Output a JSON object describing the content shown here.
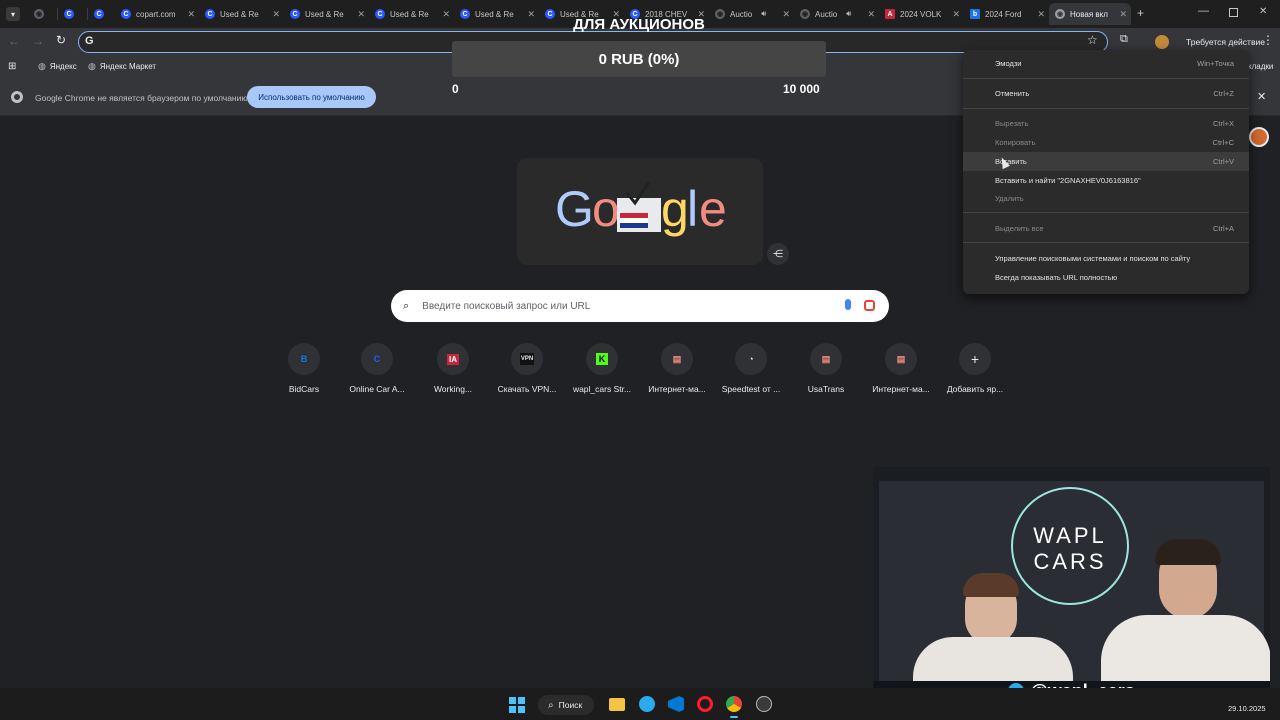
{
  "tabs": [
    {
      "title": ""
    },
    {
      "title": ""
    },
    {
      "title": "copart.com"
    },
    {
      "title": "Used & Re"
    },
    {
      "title": "Used & Re"
    },
    {
      "title": "Used & Re"
    },
    {
      "title": "Used & Re"
    },
    {
      "title": "Used & Re"
    },
    {
      "title": "2018 CHEV"
    },
    {
      "title": "Auctio"
    },
    {
      "title": "Auctio"
    },
    {
      "title": "2024 VOLK"
    },
    {
      "title": "2024 Ford"
    },
    {
      "title": "Новая вкл"
    }
  ],
  "toolbar": {
    "action_required": "Требуется действие"
  },
  "bookmarks": {
    "items": [
      "Яндекс",
      "Яндекс Маркет"
    ],
    "all_bookmarks_fragment": "кладки"
  },
  "infobar": {
    "text": "Google Chrome не является браузером по умолчанию.",
    "button": "Использовать по умолчанию"
  },
  "overlay": {
    "title": "ДЛЯ АУКЦИОНОВ",
    "amount": "0 RUB (0%)",
    "scale_min": "0",
    "scale_max": "10 000"
  },
  "search": {
    "placeholder": "Введите поисковый запрос или URL"
  },
  "shortcuts": [
    {
      "label": "BidCars",
      "glyph": "B",
      "color": "#1a73e8"
    },
    {
      "label": "Online Car A...",
      "glyph": "C",
      "color": "#2b59ff"
    },
    {
      "label": "Working...",
      "glyph": "IA",
      "color": "#c5283d"
    },
    {
      "label": "Скачать VPN...",
      "glyph": "VPN",
      "color": "#111111"
    },
    {
      "label": "wapl_cars Str...",
      "glyph": "K",
      "color": "#53fc18"
    },
    {
      "label": "Интернет-ма...",
      "glyph": "▤",
      "color": "#e8eaed"
    },
    {
      "label": "Speedtest от ...",
      "glyph": "◔",
      "color": "#e8eaed"
    },
    {
      "label": "UsaTrans",
      "glyph": "▤",
      "color": "#e8eaed"
    },
    {
      "label": "Интернет-ма...",
      "glyph": "▤",
      "color": "#e8eaed"
    },
    {
      "label": "Добавить яр...",
      "glyph": "+",
      "color": "#e8eaed"
    }
  ],
  "context_menu": {
    "items": [
      {
        "label": "Эмодзи",
        "shortcut": "Win+Точка"
      },
      {
        "label": "Отменить",
        "shortcut": "Ctrl+Z"
      },
      {
        "label": "Вырезать",
        "shortcut": "Ctrl+X"
      },
      {
        "label": "Копировать",
        "shortcut": "Ctrl+C"
      },
      {
        "label": "Вставить",
        "shortcut": "Ctrl+V"
      },
      {
        "label": "Вставить и найти \"2GNAXHEV0J6163816\"",
        "shortcut": ""
      },
      {
        "label": "Удалить",
        "shortcut": ""
      },
      {
        "label": "Выделить все",
        "shortcut": "Ctrl+A"
      },
      {
        "label": "Управление поисковыми системами и поиском по сайту",
        "shortcut": ""
      },
      {
        "label": "Всегда показывать URL полностью",
        "shortcut": ""
      }
    ]
  },
  "webcam": {
    "logo_line1": "WAPL",
    "logo_line2": "CARS",
    "handle": "@wapl_cars"
  },
  "taskbar": {
    "search_label": "Поиск",
    "date": "29.10.2025"
  }
}
